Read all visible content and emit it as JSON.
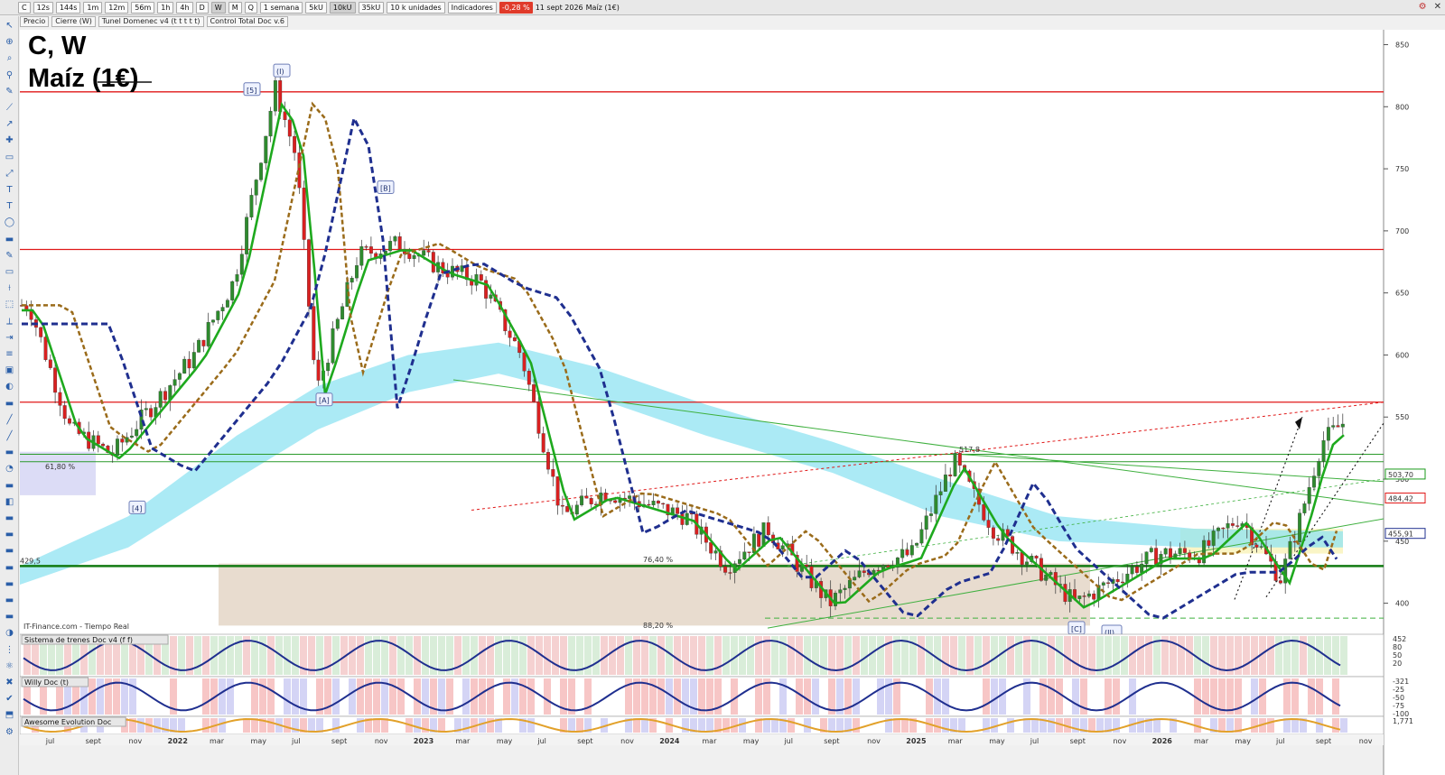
{
  "toolbar": {
    "symbol": "C",
    "timeframes": [
      "12s",
      "144s",
      "1m",
      "12m",
      "56m",
      "1h",
      "4h",
      "D",
      "W",
      "M",
      "Q"
    ],
    "active_timeframe": "W",
    "period": "1 semana",
    "volumes": [
      "5kU",
      "10kU",
      "35kU"
    ],
    "units": "10 k unidades",
    "indicators": "Indicadores",
    "change": "-0,28 %",
    "date": "11 sept 2026",
    "instrument": "Maíz (1€)"
  },
  "legend": [
    "Precio",
    "Cierre (W)",
    "Tunel Domenec v4 (t t t t t)",
    "Control Total Doc v.6"
  ],
  "chart_title": {
    "line1": "C, W",
    "line2": "Maíz (1€)"
  },
  "source_note": "IT-Finance.com - Tiempo Real",
  "colors": {
    "up": "#1a9a1a",
    "down": "#e01818",
    "accent_blue": "#1f2f8f",
    "cyan_band": "#8fe3f2",
    "sand_zone": "#e6d8c8"
  },
  "chart_data": {
    "type": "line",
    "title": "C, W — Maíz (1€)",
    "ylim": [
      375,
      862
    ],
    "y_ticks": [
      400,
      450,
      500,
      550,
      600,
      650,
      700,
      750,
      800,
      850
    ],
    "x_labels": [
      "jul",
      "sept",
      "nov",
      "2022",
      "mar",
      "may",
      "jul",
      "sept",
      "nov",
      "2023",
      "mar",
      "may",
      "jul",
      "sept",
      "nov",
      "2024",
      "mar",
      "may",
      "jul",
      "sept",
      "nov",
      "2025",
      "mar",
      "may",
      "jul",
      "sept",
      "nov",
      "2026",
      "mar",
      "may",
      "jul",
      "sept",
      "nov"
    ],
    "series": [
      {
        "name": "Cierre (W)",
        "x": [
          "2021-05",
          "2021-07",
          "2021-09",
          "2021-11",
          "2022-01",
          "2022-03",
          "2022-05",
          "2022-06",
          "2022-07",
          "2022-09",
          "2022-11",
          "2023-01",
          "2023-03",
          "2023-05",
          "2023-07",
          "2023-09",
          "2023-11",
          "2024-01",
          "2024-03",
          "2024-05",
          "2024-07",
          "2024-08",
          "2024-10",
          "2024-12",
          "2025-02",
          "2025-04",
          "2025-06",
          "2025-08",
          "2025-10",
          "2025-12",
          "2026-02",
          "2026-04",
          "2026-06",
          "2026-07",
          "2026-08",
          "2026-09"
        ],
        "values": [
          640,
          540,
          520,
          560,
          600,
          660,
          815,
          760,
          570,
          680,
          690,
          670,
          660,
          600,
          470,
          490,
          480,
          470,
          430,
          460,
          420,
          400,
          430,
          440,
          515,
          460,
          430,
          400,
          420,
          440,
          440,
          470,
          420,
          470,
          530,
          545
        ]
      }
    ],
    "horizontal_levels": [
      812,
      685,
      562,
      520,
      514,
      430
    ],
    "level_labels": {
      "517,8": 517.8,
      "429,5": 429.5,
      "76,40 %": 432,
      "88,20 %": 382,
      "61,80 %": 509
    },
    "right_price_labels": [
      "503,70",
      "484,42",
      "455,91"
    ],
    "wave_labels": [
      "[5]",
      "(I)",
      "[B]",
      "[A]",
      "[4]",
      "[C]",
      "(II)"
    ]
  },
  "panels": [
    {
      "title": "Sistema de trenes Doc v4 (f f)",
      "values": [
        "452",
        "80",
        "50",
        "20"
      ]
    },
    {
      "title": "Willy Doc (t)",
      "values": [
        "-321",
        "-25",
        "-50",
        "-75",
        "-100"
      ]
    },
    {
      "title": "Awesome Evolution Doc",
      "values": [
        "1,771"
      ]
    }
  ]
}
